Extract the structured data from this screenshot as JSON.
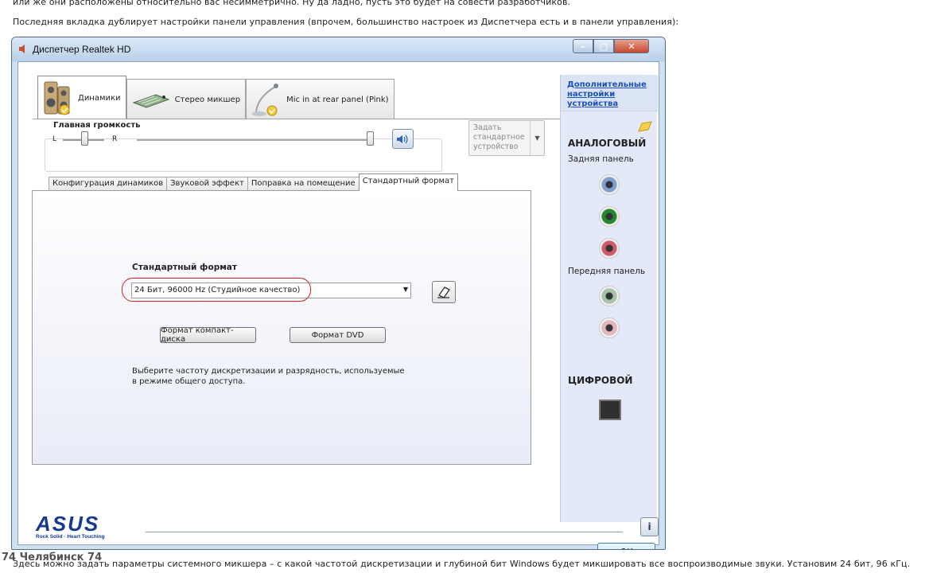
{
  "article": {
    "top_line": "или же они расположены относительно вас несимметрично. Ну да ладно, пусть это будет на совести разработчиков.",
    "intro": "Последняя вкладка дублирует настройки панели управления (впрочем, большинство настроек из Диспетчера есть и в панели управления):",
    "bottom_line": "Здесь можно задать параметры системного микшера – с какой частотой дискретизации и глубиной бит Windows будет микшировать все воспроизводимые звуки. Установим 24 бит, 96 кГц.",
    "watermark": "74 Челябинск 74"
  },
  "window": {
    "title": "Диспетчер Realtek HD",
    "controls": {
      "minimize": "–",
      "maximize": "□",
      "close": "✕"
    }
  },
  "device_tabs": [
    {
      "label": "Динамики",
      "icon": "speakers-icon",
      "active": true
    },
    {
      "label": "Стерео микшер",
      "icon": "mixer-board-icon",
      "active": false
    },
    {
      "label": "Mic in at rear panel (Pink)",
      "icon": "microphone-icon",
      "active": false
    }
  ],
  "volume": {
    "label": "Главная громкость",
    "left": "L",
    "right": "R",
    "balance": 0.5,
    "level": 1.0
  },
  "set_default": {
    "label": "Задать стандартное устройство",
    "arrow": "▼"
  },
  "sub_tabs": [
    {
      "label": "Конфигурация динамиков",
      "active": false
    },
    {
      "label": "Звуковой эффект",
      "active": false
    },
    {
      "label": "Поправка на помещение",
      "active": false
    },
    {
      "label": "Стандартный формат",
      "active": true
    }
  ],
  "format": {
    "heading": "Стандартный формат",
    "selected": "24 Бит, 96000 Hz (Студийное качество)",
    "arrow": "▼",
    "cd_button": "Формат компакт-диска",
    "dvd_button": "Формат DVD",
    "description": "Выберите частоту дискретизации и разрядность, используемые в режиме общего доступа."
  },
  "side_panel": {
    "link": "Дополнительные настройки устройства",
    "analog": "АНАЛОГОВЫЙ",
    "rear": "Задняя панель",
    "front": "Передняя панель",
    "digital": "ЦИФРОВОЙ",
    "rear_jacks": [
      "#7f9fce",
      "#1f8a2c",
      "#d05868"
    ],
    "front_jacks": [
      "#a7c2a8",
      "#e2b6bd"
    ]
  },
  "brand": {
    "logo": "ASUS",
    "tagline": "Rock Solid · Heart Touching"
  },
  "footer": {
    "info": "i",
    "ok": "OK"
  },
  "colors": {
    "highlight_oval": "#d81f1f",
    "link": "#1a4fbf",
    "window_frame": "#cfe0f2"
  }
}
